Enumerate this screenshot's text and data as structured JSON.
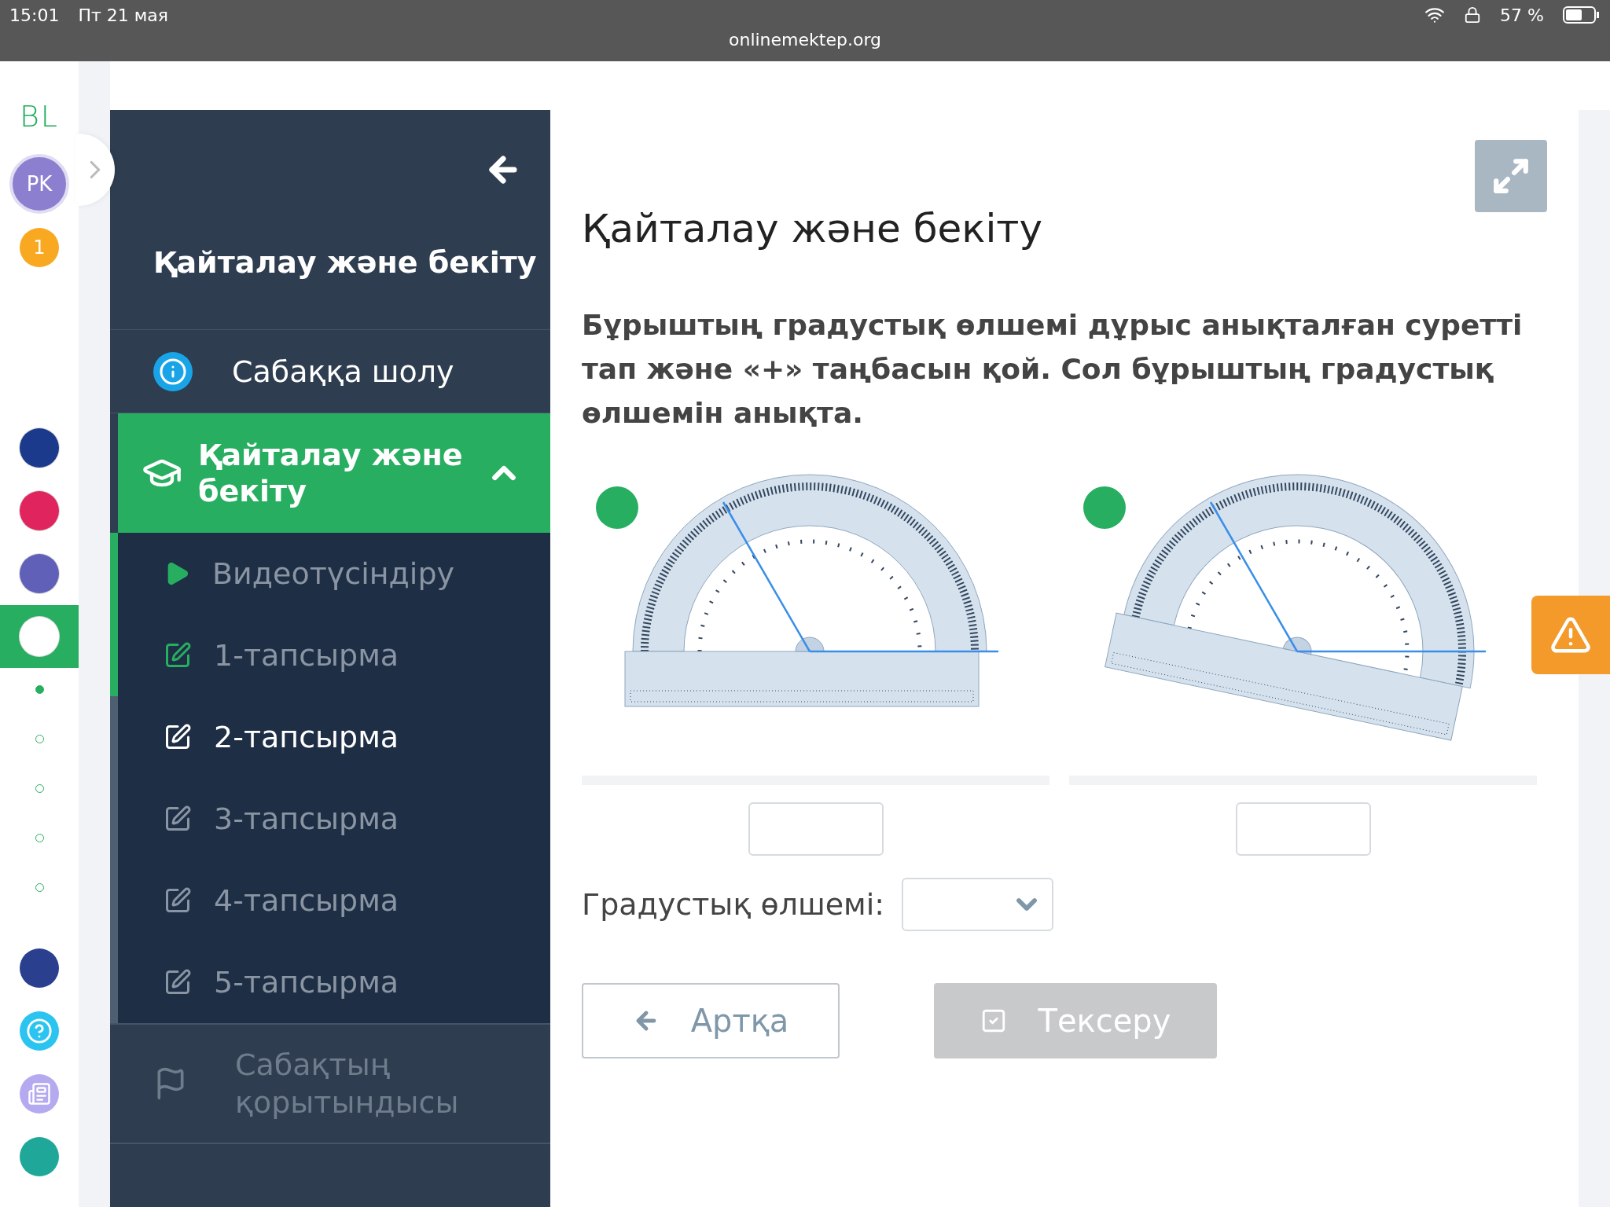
{
  "status_bar": {
    "time": "15:01",
    "date": "Пт 21 мая",
    "url": "onlinemektep.org",
    "battery": "57 %"
  },
  "rail": {
    "logo": "BL",
    "avatar": "PK",
    "badge": "1",
    "apps": [
      {
        "color": "#1b3a8c",
        "selected": false
      },
      {
        "color": "#e0245e",
        "selected": false
      },
      {
        "color": "#6160b8",
        "selected": false
      },
      {
        "color": "#ffffff",
        "selected": true
      }
    ],
    "steps": [
      {
        "selected": true
      },
      {
        "selected": false
      },
      {
        "selected": false
      },
      {
        "selected": false
      },
      {
        "selected": false
      }
    ],
    "tools": [
      {
        "kind": "smart",
        "color": "#2b3f8f"
      },
      {
        "kind": "help",
        "color": "#2bc4f0"
      },
      {
        "kind": "news",
        "color": "#b3aaf0"
      },
      {
        "kind": "partial",
        "color": "#1fa89a"
      }
    ]
  },
  "sidebar": {
    "title": "Қайталау және бекіту",
    "overview": {
      "label": "Сабаққа шолу"
    },
    "section": {
      "label": "Қайталау және бекіту",
      "expanded": true,
      "children": [
        {
          "kind": "video",
          "label": "Видеотүсіндіру",
          "completed": true,
          "selected": false
        },
        {
          "kind": "task",
          "label": "1-тапсырма",
          "completed": true,
          "selected": false
        },
        {
          "kind": "task",
          "label": "2-тапсырма",
          "completed": false,
          "selected": true
        },
        {
          "kind": "task",
          "label": "3-тапсырма",
          "completed": false,
          "selected": false
        },
        {
          "kind": "task",
          "label": "4-тапсырма",
          "completed": false,
          "selected": false
        },
        {
          "kind": "task",
          "label": "5-тапсырма",
          "completed": false,
          "selected": false
        }
      ]
    },
    "summary": {
      "label": "Сабақтың қорытындысы",
      "disabled": true
    }
  },
  "main": {
    "title": "Қайталау және бекіту",
    "question": "Бұрыштың градустық өлшемі дұрыс анықталған суретті тап және «+» таңбасын қой. Сол бұрыштың градустық өлшемін анықта.",
    "images": [
      {
        "kind": "picture",
        "tilted": false
      },
      {
        "kind": "picture",
        "tilted": true
      }
    ],
    "answer_label": "Градустық өлшемі:",
    "back_button": "Артқа",
    "check_button": {
      "label": "Тексеру",
      "disabled": true
    }
  }
}
